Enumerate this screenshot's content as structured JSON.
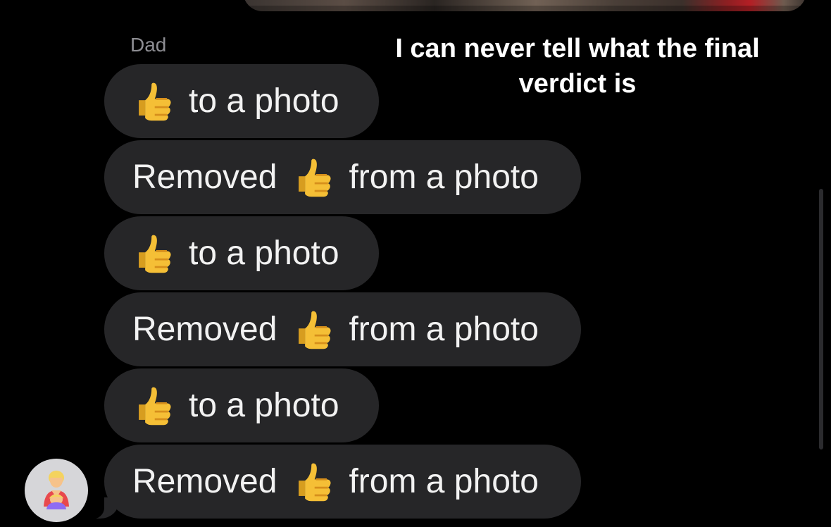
{
  "chat": {
    "sender_name": "Dad",
    "caption": "I can never tell what the final verdict is",
    "messages": [
      {
        "prefix": "",
        "icon": "thumbs-up-icon",
        "suffix": "to a photo"
      },
      {
        "prefix": "Removed",
        "icon": "thumbs-up-icon",
        "suffix": "from a photo"
      },
      {
        "prefix": "",
        "icon": "thumbs-up-icon",
        "suffix": "to a photo"
      },
      {
        "prefix": "Removed",
        "icon": "thumbs-up-icon",
        "suffix": "from a photo"
      },
      {
        "prefix": "",
        "icon": "thumbs-up-icon",
        "suffix": "to a photo"
      },
      {
        "prefix": "Removed",
        "icon": "thumbs-up-icon",
        "suffix": "from a photo"
      }
    ],
    "avatar_icon": "parent-with-baby-icon"
  },
  "colors": {
    "background": "#000000",
    "bubble": "#262628",
    "text": "#f2f2f2",
    "sender": "#8e8e93",
    "thumb": "#f2b62f"
  }
}
